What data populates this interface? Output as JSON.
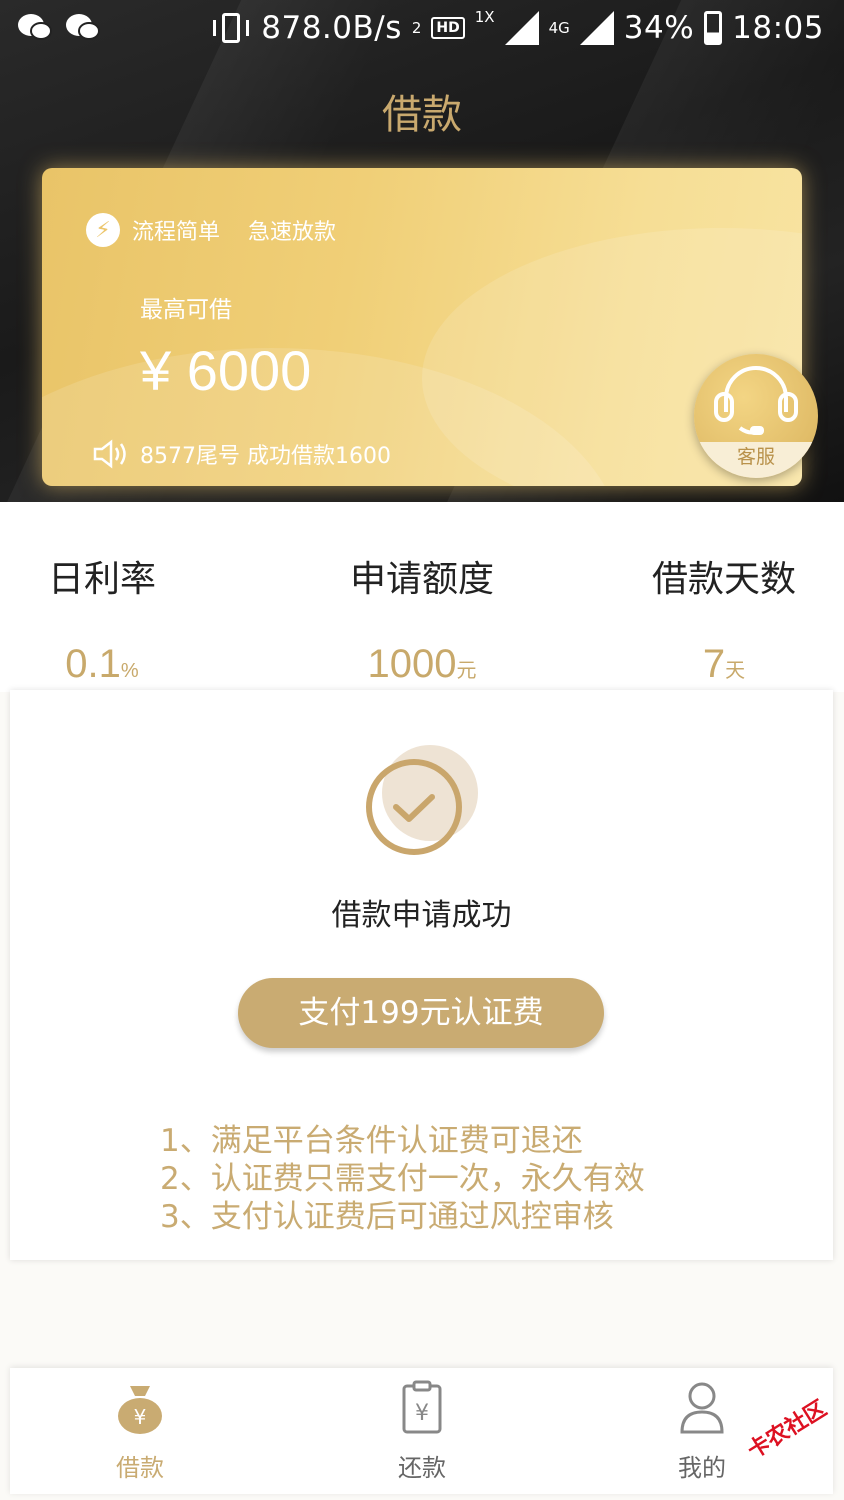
{
  "status_bar": {
    "network_speed": "878.0B/s",
    "hd_badge": "HD",
    "hd_sub": "2",
    "sim_1x": "1X",
    "net_4g": "4G",
    "battery": "34%",
    "time": "18:05"
  },
  "header": {
    "title": "借款"
  },
  "card": {
    "feature_1": "流程简单",
    "feature_2": "急速放款",
    "max_label": "最高可借",
    "max_amount": "¥ 6000",
    "notice": "8577尾号 成功借款1600",
    "service_label": "客服"
  },
  "stats": [
    {
      "label": "日利率",
      "value": "0.1",
      "unit": "%"
    },
    {
      "label": "申请额度",
      "value": "1000",
      "unit": "元"
    },
    {
      "label": "借款天数",
      "value": "7",
      "unit": "天"
    }
  ],
  "result": {
    "title": "借款申请成功",
    "pay_button": "支付199元认证费",
    "rules": [
      "1、满足平台条件认证费可退还",
      "2、认证费只需支付一次，永久有效",
      "3、支付认证费后可通过风控审核"
    ]
  },
  "tabs": [
    {
      "label": "借款",
      "active": true
    },
    {
      "label": "还款",
      "active": false
    },
    {
      "label": "我的",
      "active": false
    }
  ],
  "watermark": "卡农社区",
  "colors": {
    "gold": "#c9ab72",
    "card_gold": "#f0cf77",
    "dark": "#1a1a1a"
  }
}
